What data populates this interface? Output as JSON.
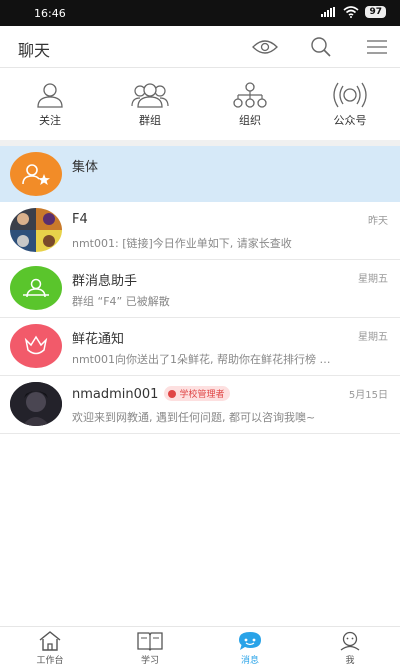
{
  "status_bar": {
    "time": "16:46",
    "battery": "97"
  },
  "header": {
    "title": "聊天",
    "icons": [
      "eye-icon",
      "search-icon",
      "menu-icon"
    ]
  },
  "quick_actions": [
    {
      "label": "关注",
      "icon": "person-icon"
    },
    {
      "label": "群组",
      "icon": "group-icon"
    },
    {
      "label": "组织",
      "icon": "org-chart-icon"
    },
    {
      "label": "公众号",
      "icon": "broadcast-icon"
    }
  ],
  "conversations": [
    {
      "name": "集体",
      "preview": "",
      "time": "",
      "avatar_color": "#f28c28",
      "highlighted": true
    },
    {
      "name": "F4",
      "preview": "nmt001: [链接]今日作业单如下, 请家长查收",
      "time": "昨天"
    },
    {
      "name": "群消息助手",
      "preview": "群组 “F4” 已被解散",
      "time": "星期五",
      "avatar_color": "#5ac52c"
    },
    {
      "name": "鲜花通知",
      "preview": "nmt001向你送出了1朵鲜花, 帮助你在鲜花排行榜 …",
      "time": "星期五",
      "avatar_color": "#f25a6a"
    },
    {
      "name": "nmadmin001",
      "badge": "学校管理者",
      "preview": "欢迎来到网教通, 遇到任何问题, 都可以咨询我噢~",
      "time": "5月15日"
    }
  ],
  "tabs": [
    {
      "label": "工作台",
      "icon": "home-icon"
    },
    {
      "label": "学习",
      "icon": "book-icon"
    },
    {
      "label": "消息",
      "icon": "chat-icon",
      "active": true
    },
    {
      "label": "我",
      "icon": "profile-icon"
    }
  ],
  "colors": {
    "accent": "#29a3e8",
    "highlight_row": "#d6e9f8"
  }
}
